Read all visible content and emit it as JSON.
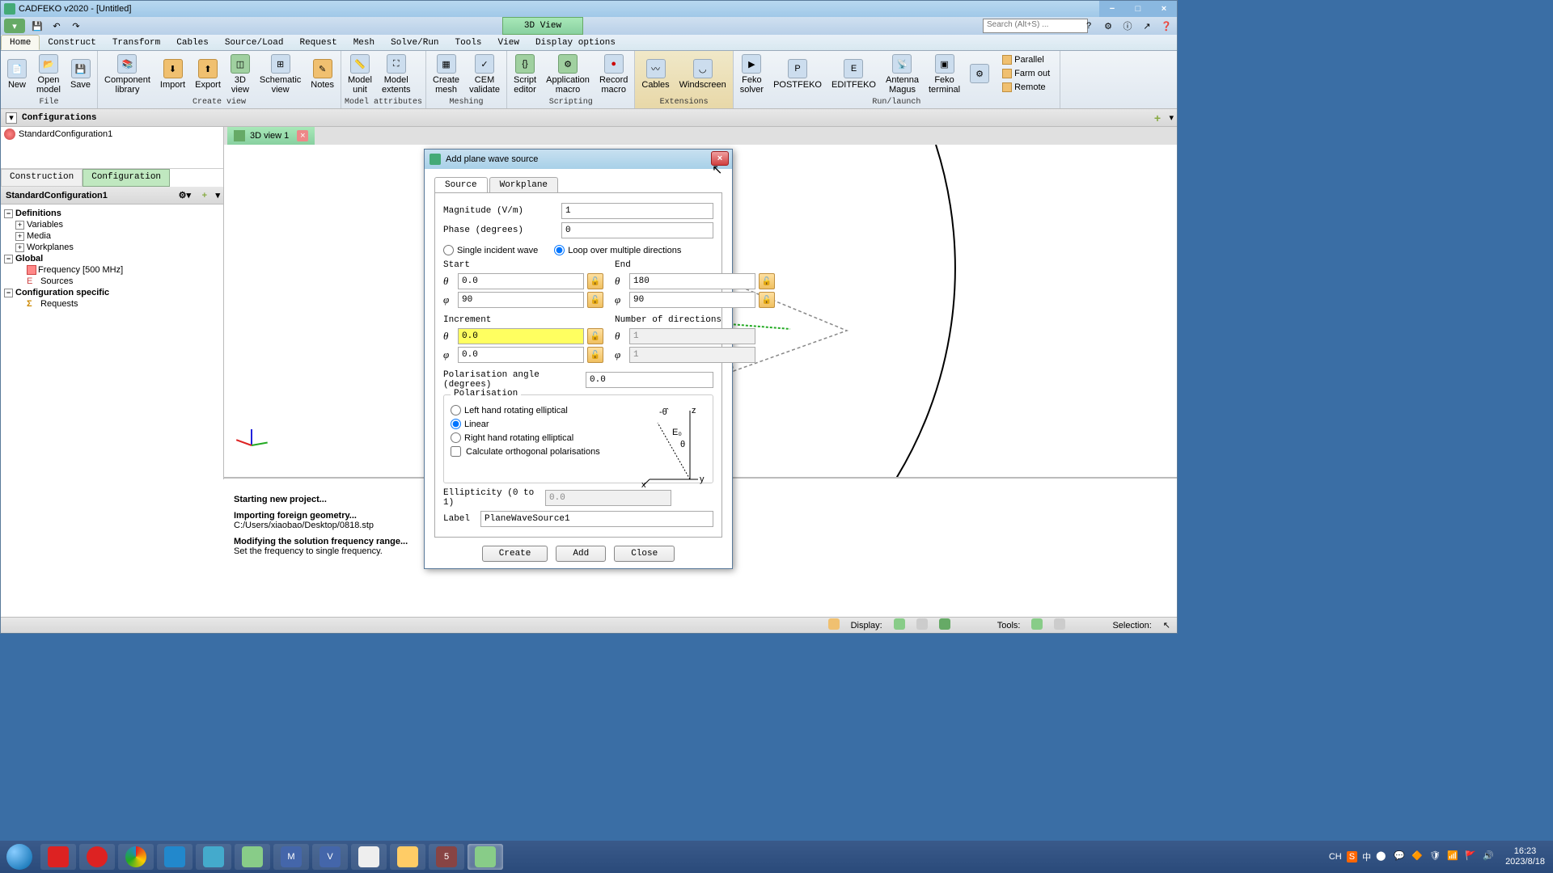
{
  "window": {
    "title": "CADFEKO v2020 - [Untitled]",
    "view_3d_tab": "3D View",
    "search_placeholder": "Search (Alt+S) ..."
  },
  "menu": {
    "tabs": [
      "Home",
      "Construct",
      "Transform",
      "Cables",
      "Source/Load",
      "Request",
      "Mesh",
      "Solve/Run",
      "Tools",
      "View",
      "Display options"
    ]
  },
  "ribbon": {
    "file": {
      "label": "File",
      "new": "New",
      "open_model": "Open\nmodel",
      "save": "Save"
    },
    "create_view": {
      "label": "Create view",
      "component_library": "Component\nlibrary",
      "import": "Import",
      "export": "Export",
      "view_3d": "3D\nview",
      "schematic_view": "Schematic\nview",
      "notes": "Notes"
    },
    "model_attributes": {
      "label": "Model attributes",
      "model_unit": "Model\nunit",
      "model_extents": "Model\nextents"
    },
    "meshing": {
      "label": "Meshing",
      "create_mesh": "Create\nmesh",
      "cem_validate": "CEM\nvalidate"
    },
    "scripting": {
      "label": "Scripting",
      "script_editor": "Script\neditor",
      "application_macro": "Application\nmacro",
      "record_macro": "Record\nmacro"
    },
    "extensions": {
      "label": "Extensions",
      "cables": "Cables",
      "windscreen": "Windscreen"
    },
    "run": {
      "label": "Run/launch",
      "feko_solver": "Feko\nsolver",
      "postfeko": "POSTFEKO",
      "editfeko": "EDITFEKO",
      "antenna_magus": "Antenna\nMagus",
      "feko_terminal": "Feko\nterminal",
      "parallel": "Parallel",
      "farm_out": "Farm out",
      "remote": "Remote"
    }
  },
  "config": {
    "bar_title": "Configurations",
    "item": "StandardConfiguration1",
    "tabs": {
      "construction": "Construction",
      "configuration": "Configuration"
    },
    "panel_title": "StandardConfiguration1"
  },
  "tree": {
    "definitions": "Definitions",
    "variables": "Variables",
    "media": "Media",
    "workplanes": "Workplanes",
    "global": "Global",
    "frequency": "Frequency [500 MHz]",
    "sources": "Sources",
    "specific": "Configuration specific",
    "requests": "Requests"
  },
  "view_tab": {
    "label": "3D view 1"
  },
  "messages": {
    "m1h": "Starting new project...",
    "m2h": "Importing foreign geometry...",
    "m2b": "C:/Users/xiaobao/Desktop/0818.stp",
    "m3h": "Modifying the solution frequency range...",
    "m3b": "Set the frequency to single frequency."
  },
  "status": {
    "display": "Display:",
    "tools": "Tools:",
    "selection": "Selection:"
  },
  "dialog": {
    "title": "Add plane wave source",
    "tabs": {
      "source": "Source",
      "workplane": "Workplane"
    },
    "magnitude_label": "Magnitude (V/m)",
    "magnitude_value": "1",
    "phase_label": "Phase (degrees)",
    "phase_value": "0",
    "single": "Single incident wave",
    "loop": "Loop over multiple directions",
    "start": "Start",
    "end": "End",
    "increment": "Increment",
    "num_dir": "Number of directions",
    "start_theta": "0.0",
    "start_phi": "90",
    "end_theta": "180",
    "end_phi": "90",
    "inc_theta": "0.0",
    "inc_phi": "0.0",
    "num_theta": "1",
    "num_phi": "1",
    "pol_angle_label": "Polarisation angle (degrees)",
    "pol_angle_value": "0.0",
    "pol_group": "Polarisation",
    "pol_left": "Left hand rotating elliptical",
    "pol_linear": "Linear",
    "pol_right": "Right hand rotating elliptical",
    "calc_orth": "Calculate orthogonal polarisations",
    "ellipticity_label": "Ellipticity (0 to 1)",
    "ellipticity_value": "0.0",
    "label_label": "Label",
    "label_value": "PlaneWaveSource1",
    "create": "Create",
    "add": "Add",
    "close": "Close"
  },
  "systray": {
    "time": "16:23",
    "date": "2023/8/18",
    "ime": "CH",
    "lang": "中"
  }
}
